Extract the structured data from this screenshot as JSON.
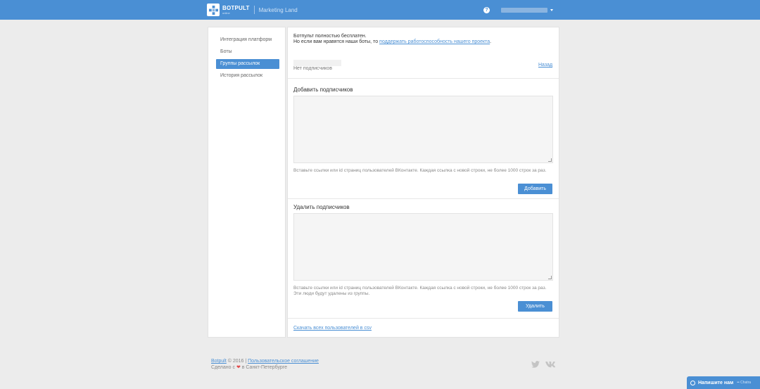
{
  "header": {
    "brand_name": "BOTPULT",
    "brand_sub": "online",
    "project_name": "Marketing Land",
    "help_symbol": "?",
    "colors": {
      "bar": "#4a8fd4"
    }
  },
  "sidebar": {
    "items": [
      {
        "label": "Интеграция платформ",
        "active": false
      },
      {
        "label": "Боты",
        "active": false
      },
      {
        "label": "Группы рассылок",
        "active": true
      },
      {
        "label": "История рассылок",
        "active": false
      }
    ]
  },
  "notice": {
    "line1": "Ботпульт полностью бесплатен.",
    "line2_prefix": "Но если вам нравятся наши боты, то ",
    "line2_link": "поддержать работоспособность нашего проекта",
    "line2_suffix": "."
  },
  "group": {
    "subscribers_status": "Нет подписчиков",
    "back_link": "Назад"
  },
  "add_section": {
    "title": "Добавить подписчиков",
    "hint": "Вставьте ссылки или id страниц пользователей ВКонтакте. Каждая ссылка с новой строки, не более 1000 строк за раз.",
    "button": "Добавить"
  },
  "remove_section": {
    "title": "Удалить подписчиков",
    "hint": "Вставьте ссылки или id страниц пользователей ВКонтакте. Каждая ссылка с новой строки, не более 1000 строк за раз. Эти люди будут удалены из группы.",
    "button": "Удалить"
  },
  "export_link": "Скачать всех пользователей в csv",
  "footer": {
    "brand_link": "Botpult",
    "copyright": " © 2016 | ",
    "terms_link": "Пользовательское соглашение",
    "made_prefix": "Сделано с ",
    "heart": "❤",
    "made_suffix": " в Санкт-Петербурге"
  },
  "chat_widget": {
    "label": "Напишите нам",
    "brand": "•• Chatra"
  }
}
